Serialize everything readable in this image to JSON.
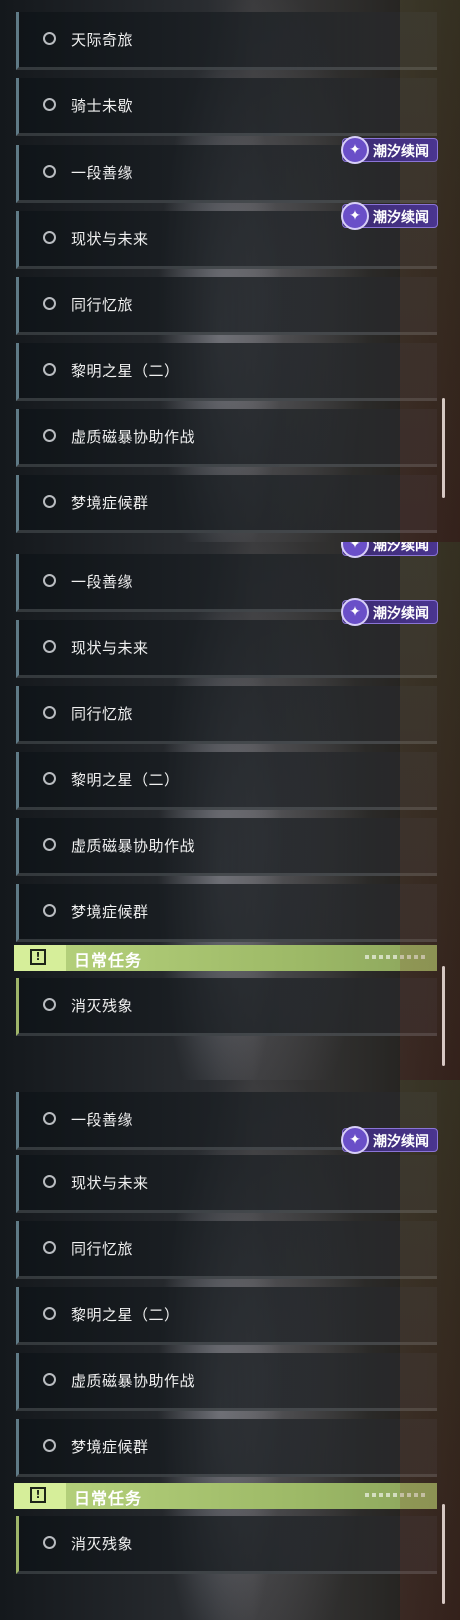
{
  "screens": [
    {
      "quests": [
        "天际奇旅",
        "骑士未歇",
        "一段善缘",
        "现状与未来",
        "同行忆旅",
        "黎明之星（二）",
        "虚质磁暴协助作战",
        "梦境症候群"
      ],
      "badges": [
        "潮汐续闻",
        "潮汐续闻"
      ]
    },
    {
      "quests": [
        "一段善缘",
        "现状与未来",
        "同行忆旅",
        "黎明之星（二）",
        "虚质磁暴协助作战",
        "梦境症候群"
      ],
      "badges": [
        "潮汐续闻",
        "潮汐续闻"
      ],
      "daily_header": "日常任务",
      "daily_quests": [
        "消灭残象"
      ]
    },
    {
      "quests": [
        "一段善缘",
        "现状与未来",
        "同行忆旅",
        "黎明之星（二）",
        "虚质磁暴协助作战",
        "梦境症候群"
      ],
      "badges": [
        "潮汐续闻"
      ],
      "daily_header": "日常任务",
      "daily_quests": [
        "消灭残象"
      ]
    }
  ],
  "icons": {
    "quest_marker": "circle-icon",
    "badge": "tide-badge-icon",
    "daily": "alert-box-icon"
  },
  "colors": {
    "badge_bg": "#4a3590",
    "daily_accent": "#b8d47e",
    "item_border": "#5f7a86"
  }
}
